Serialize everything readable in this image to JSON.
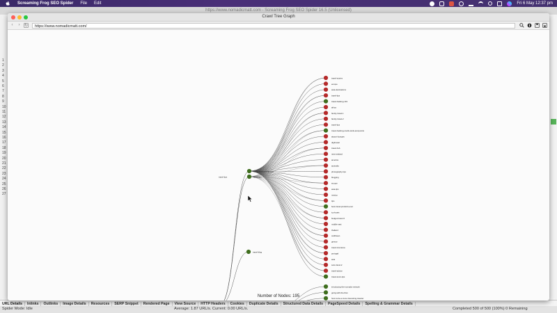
{
  "menubar": {
    "app_name": "Screaming Frog SEO Spider",
    "items": [
      "File",
      "Edit"
    ],
    "clock": "Fri 6 May  12:37 pm"
  },
  "background_window": {
    "title": "https://www.nomadicmatt.com - Screaming Frog SEO Spider 16.5 (Unlicensed)",
    "row_numbers": [
      "1",
      "2",
      "3",
      "4",
      "5",
      "6",
      "7",
      "8",
      "9",
      "10",
      "11",
      "12",
      "13",
      "14",
      "15",
      "16",
      "17",
      "18",
      "19",
      "20",
      "21",
      "22",
      "23",
      "24",
      "25",
      "26",
      "27"
    ],
    "tabs": [
      "URL Details",
      "Inlinks",
      "Outlinks",
      "Image Details",
      "Resources",
      "SERP Snippet",
      "Rendered Page",
      "View Source",
      "HTTP Headers",
      "Cookies",
      "Duplicate Details",
      "Structured Data Details",
      "PageSpeed Details",
      "Spelling & Grammar Details"
    ],
    "status": {
      "mode": "Spider Mode: Idle",
      "average": "Average: 1.87 URL/s. Current: 0.00 URL/s.",
      "completed": "Completed 500 of 500 (100%) 0 Remaining"
    }
  },
  "graph_window": {
    "title": "Crawl Tree Graph",
    "url": "https://www.nomadicmatt.com/",
    "node_count_label": "Number of Nodes: 195"
  },
  "colors": {
    "node_red": "#b52a2a",
    "node_green": "#3f6e1e",
    "edge": "#555555"
  },
  "icons": [
    "apple-icon",
    "back-icon",
    "forward-icon",
    "refresh-icon",
    "search-icon",
    "info-icon",
    "save-icon",
    "export-icon",
    "mouse-pointer-icon"
  ],
  "tree": {
    "root_label": "travel-tips",
    "hubs": [
      {
        "label": "travel-tips/travel-guides",
        "color": "green"
      },
      {
        "label": "tours-tips",
        "color": "green"
      },
      {
        "label": "travel-blog",
        "color": "green"
      }
    ],
    "leaves": [
      {
        "label": "travel-stories",
        "color": "red"
      },
      {
        "label": "europe",
        "color": "red"
      },
      {
        "label": "asia-destinations",
        "color": "red"
      },
      {
        "label": "travel-tips",
        "color": "red"
      },
      {
        "label": "travel-hacking-101",
        "color": "green"
      },
      {
        "label": "africa",
        "color": "red"
      },
      {
        "label": "family-travel-1",
        "color": "red"
      },
      {
        "label": "family-travel-2",
        "color": "red"
      },
      {
        "label": "travel-tips",
        "color": "red"
      },
      {
        "label": "travel-hacking-credit-cards-and-points",
        "color": "green"
      },
      {
        "label": "airport-lounges",
        "color": "red"
      },
      {
        "label": "digihostel",
        "color": "red"
      },
      {
        "label": "travel-hub",
        "color": "red"
      },
      {
        "label": "new-zealand",
        "color": "red"
      },
      {
        "label": "america",
        "color": "red"
      },
      {
        "label": "australia",
        "color": "red"
      },
      {
        "label": "photography-tips",
        "color": "red"
      },
      {
        "label": "blogging",
        "color": "red"
      },
      {
        "label": "europe",
        "color": "red"
      },
      {
        "label": "asia-tips",
        "color": "red"
      },
      {
        "label": "mexico",
        "color": "red"
      },
      {
        "label": "tips",
        "color": "red"
      },
      {
        "label": "best-travel-products-ever",
        "color": "green"
      },
      {
        "label": "ico-boats",
        "color": "red"
      },
      {
        "label": "budget-travel-3",
        "color": "red"
      },
      {
        "label": "middle-east",
        "color": "red"
      },
      {
        "label": "thailand",
        "color": "red"
      },
      {
        "label": "caribbean",
        "color": "red"
      },
      {
        "label": "greece",
        "color": "red"
      },
      {
        "label": "travel-insurance",
        "color": "red"
      },
      {
        "label": "portugal",
        "color": "red"
      },
      {
        "label": "asia",
        "color": "red"
      },
      {
        "label": "solo-travel-2",
        "color": "red"
      },
      {
        "label": "travel-advice",
        "color": "red"
      },
      {
        "label": "travel-tours-tips",
        "color": "green"
      },
      {
        "label": "introducing-the-nomadic-network",
        "color": "green"
      },
      {
        "label": "going-with-the-flow",
        "color": "green"
      },
      {
        "label": "how-to-be-a-more-interesting-traveler",
        "color": "green"
      },
      {
        "label": "guide-to-round-trips",
        "color": "green"
      }
    ]
  }
}
